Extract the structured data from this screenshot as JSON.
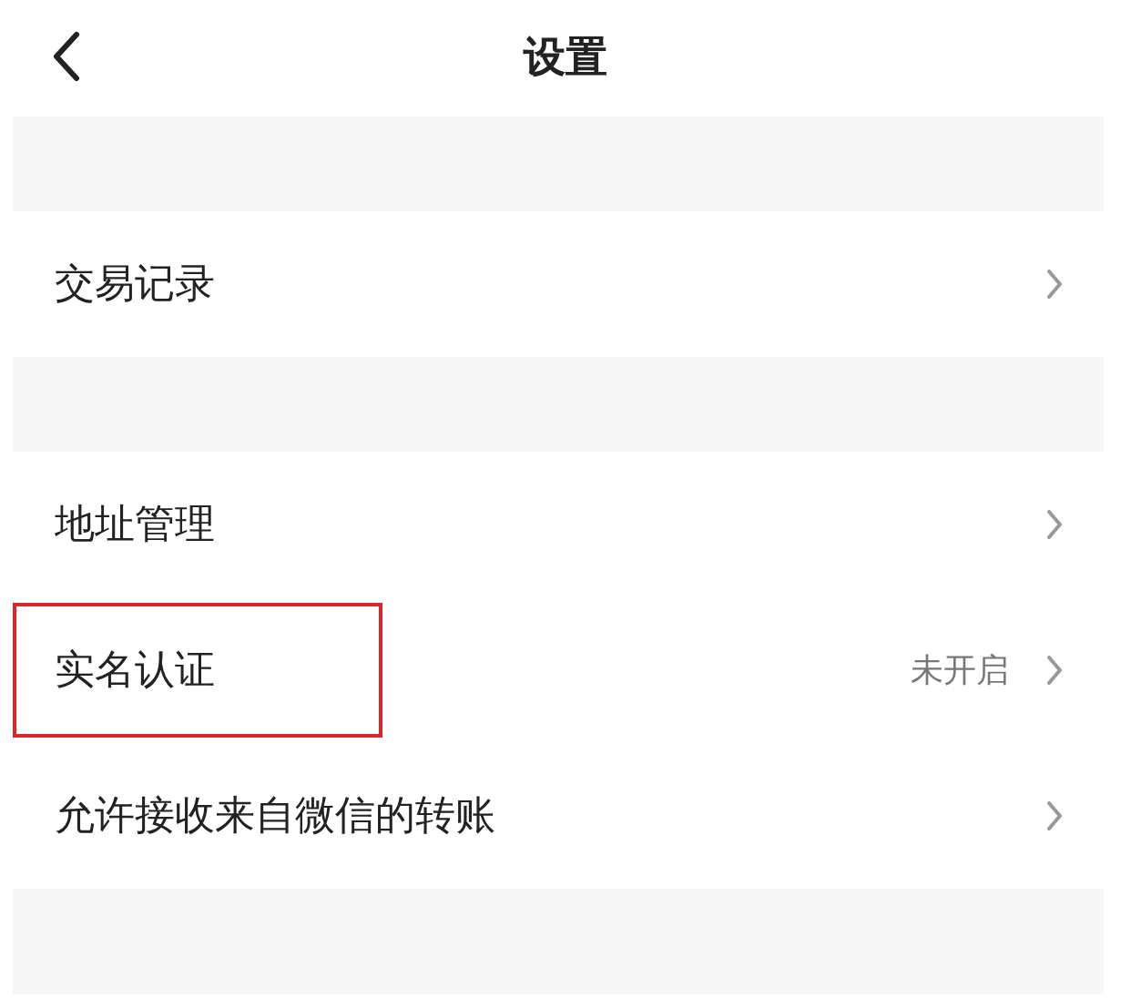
{
  "header": {
    "title": "设置"
  },
  "groups": [
    {
      "rows": [
        {
          "label": "交易记录",
          "highlighted": false
        }
      ]
    },
    {
      "rows": [
        {
          "label": "地址管理",
          "highlighted": false
        },
        {
          "label": "实名认证",
          "value": "未开启",
          "highlighted": true
        },
        {
          "label": "允许接收来自微信的转账",
          "highlighted": false
        }
      ]
    }
  ]
}
